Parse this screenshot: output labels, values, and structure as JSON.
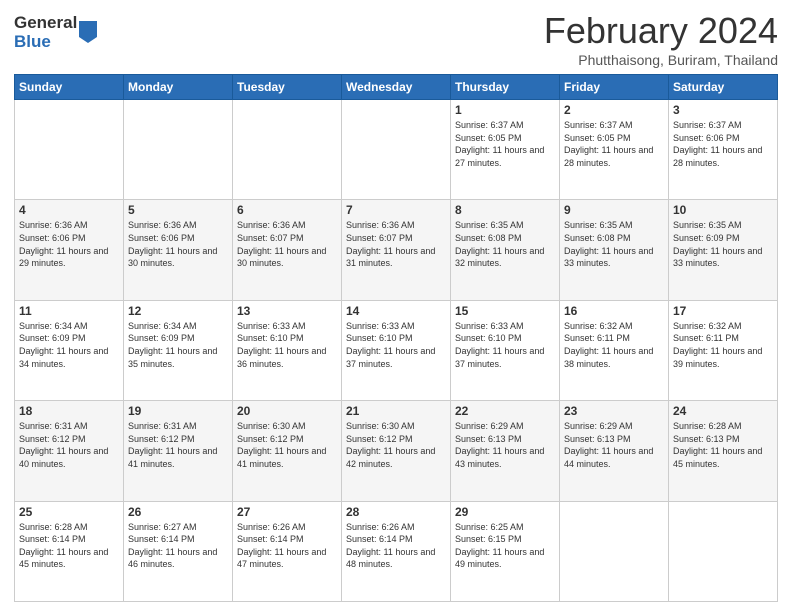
{
  "logo": {
    "general": "General",
    "blue": "Blue"
  },
  "header": {
    "title": "February 2024",
    "location": "Phutthaisong, Buriram, Thailand"
  },
  "weekdays": [
    "Sunday",
    "Monday",
    "Tuesday",
    "Wednesday",
    "Thursday",
    "Friday",
    "Saturday"
  ],
  "weeks": [
    [
      {
        "day": "",
        "info": ""
      },
      {
        "day": "",
        "info": ""
      },
      {
        "day": "",
        "info": ""
      },
      {
        "day": "",
        "info": ""
      },
      {
        "day": "1",
        "info": "Sunrise: 6:37 AM\nSunset: 6:05 PM\nDaylight: 11 hours and 27 minutes."
      },
      {
        "day": "2",
        "info": "Sunrise: 6:37 AM\nSunset: 6:05 PM\nDaylight: 11 hours and 28 minutes."
      },
      {
        "day": "3",
        "info": "Sunrise: 6:37 AM\nSunset: 6:06 PM\nDaylight: 11 hours and 28 minutes."
      }
    ],
    [
      {
        "day": "4",
        "info": "Sunrise: 6:36 AM\nSunset: 6:06 PM\nDaylight: 11 hours and 29 minutes."
      },
      {
        "day": "5",
        "info": "Sunrise: 6:36 AM\nSunset: 6:06 PM\nDaylight: 11 hours and 30 minutes."
      },
      {
        "day": "6",
        "info": "Sunrise: 6:36 AM\nSunset: 6:07 PM\nDaylight: 11 hours and 30 minutes."
      },
      {
        "day": "7",
        "info": "Sunrise: 6:36 AM\nSunset: 6:07 PM\nDaylight: 11 hours and 31 minutes."
      },
      {
        "day": "8",
        "info": "Sunrise: 6:35 AM\nSunset: 6:08 PM\nDaylight: 11 hours and 32 minutes."
      },
      {
        "day": "9",
        "info": "Sunrise: 6:35 AM\nSunset: 6:08 PM\nDaylight: 11 hours and 33 minutes."
      },
      {
        "day": "10",
        "info": "Sunrise: 6:35 AM\nSunset: 6:09 PM\nDaylight: 11 hours and 33 minutes."
      }
    ],
    [
      {
        "day": "11",
        "info": "Sunrise: 6:34 AM\nSunset: 6:09 PM\nDaylight: 11 hours and 34 minutes."
      },
      {
        "day": "12",
        "info": "Sunrise: 6:34 AM\nSunset: 6:09 PM\nDaylight: 11 hours and 35 minutes."
      },
      {
        "day": "13",
        "info": "Sunrise: 6:33 AM\nSunset: 6:10 PM\nDaylight: 11 hours and 36 minutes."
      },
      {
        "day": "14",
        "info": "Sunrise: 6:33 AM\nSunset: 6:10 PM\nDaylight: 11 hours and 37 minutes."
      },
      {
        "day": "15",
        "info": "Sunrise: 6:33 AM\nSunset: 6:10 PM\nDaylight: 11 hours and 37 minutes."
      },
      {
        "day": "16",
        "info": "Sunrise: 6:32 AM\nSunset: 6:11 PM\nDaylight: 11 hours and 38 minutes."
      },
      {
        "day": "17",
        "info": "Sunrise: 6:32 AM\nSunset: 6:11 PM\nDaylight: 11 hours and 39 minutes."
      }
    ],
    [
      {
        "day": "18",
        "info": "Sunrise: 6:31 AM\nSunset: 6:12 PM\nDaylight: 11 hours and 40 minutes."
      },
      {
        "day": "19",
        "info": "Sunrise: 6:31 AM\nSunset: 6:12 PM\nDaylight: 11 hours and 41 minutes."
      },
      {
        "day": "20",
        "info": "Sunrise: 6:30 AM\nSunset: 6:12 PM\nDaylight: 11 hours and 41 minutes."
      },
      {
        "day": "21",
        "info": "Sunrise: 6:30 AM\nSunset: 6:12 PM\nDaylight: 11 hours and 42 minutes."
      },
      {
        "day": "22",
        "info": "Sunrise: 6:29 AM\nSunset: 6:13 PM\nDaylight: 11 hours and 43 minutes."
      },
      {
        "day": "23",
        "info": "Sunrise: 6:29 AM\nSunset: 6:13 PM\nDaylight: 11 hours and 44 minutes."
      },
      {
        "day": "24",
        "info": "Sunrise: 6:28 AM\nSunset: 6:13 PM\nDaylight: 11 hours and 45 minutes."
      }
    ],
    [
      {
        "day": "25",
        "info": "Sunrise: 6:28 AM\nSunset: 6:14 PM\nDaylight: 11 hours and 45 minutes."
      },
      {
        "day": "26",
        "info": "Sunrise: 6:27 AM\nSunset: 6:14 PM\nDaylight: 11 hours and 46 minutes."
      },
      {
        "day": "27",
        "info": "Sunrise: 6:26 AM\nSunset: 6:14 PM\nDaylight: 11 hours and 47 minutes."
      },
      {
        "day": "28",
        "info": "Sunrise: 6:26 AM\nSunset: 6:14 PM\nDaylight: 11 hours and 48 minutes."
      },
      {
        "day": "29",
        "info": "Sunrise: 6:25 AM\nSunset: 6:15 PM\nDaylight: 11 hours and 49 minutes."
      },
      {
        "day": "",
        "info": ""
      },
      {
        "day": "",
        "info": ""
      }
    ]
  ]
}
